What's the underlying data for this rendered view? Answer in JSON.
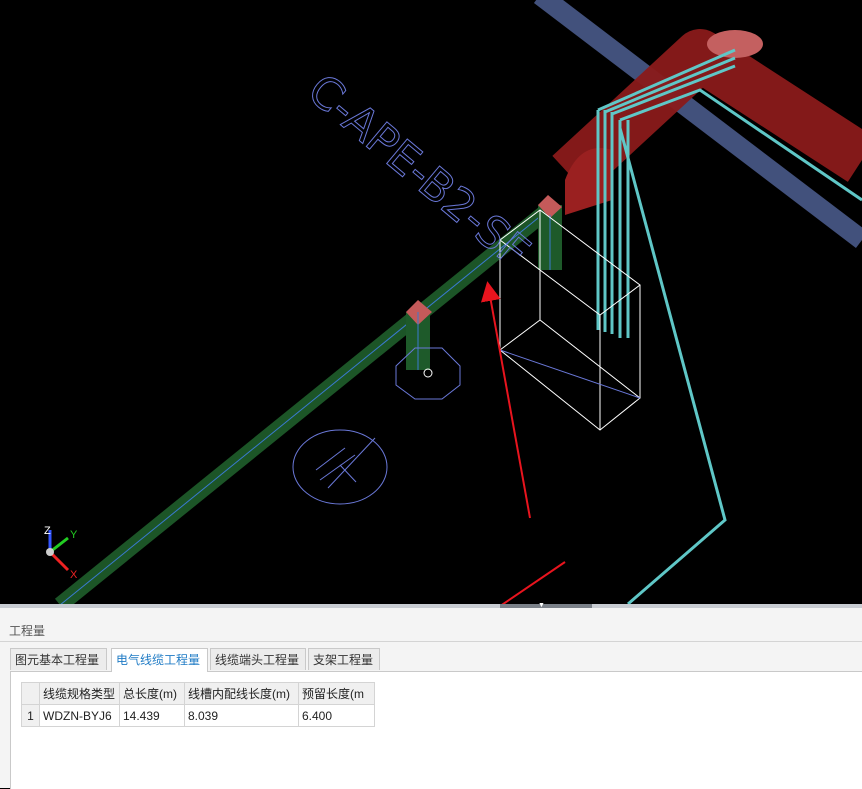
{
  "viewport": {
    "label_text": "C-APE-B2-SF",
    "axes": {
      "x": "X",
      "y": "Y",
      "z": "Z"
    },
    "colors": {
      "background": "#000000",
      "tray_green": "#1e5a2a",
      "duct_red": "#8a1a1a",
      "pipe_cyan": "#5fc7c7",
      "wire_blue": "#6a78d8",
      "box_white": "#ffffff",
      "annotation_arrow": "#e8141e",
      "beam_slate": "#4a5a8a"
    }
  },
  "panel": {
    "title": "工程量",
    "tabs": [
      {
        "label": "图元基本工程量",
        "active": false
      },
      {
        "label": "电气线缆工程量",
        "active": true
      },
      {
        "label": "线缆端头工程量",
        "active": false
      },
      {
        "label": "支架工程量",
        "active": false
      }
    ],
    "table": {
      "columns": [
        "",
        "线缆规格类型",
        "总长度(m)",
        "线槽内配线长度(m)",
        "预留长度(m"
      ],
      "rows": [
        [
          "1",
          "WDZN-BYJ6",
          "14.439",
          "8.039",
          "6.400"
        ]
      ]
    }
  }
}
